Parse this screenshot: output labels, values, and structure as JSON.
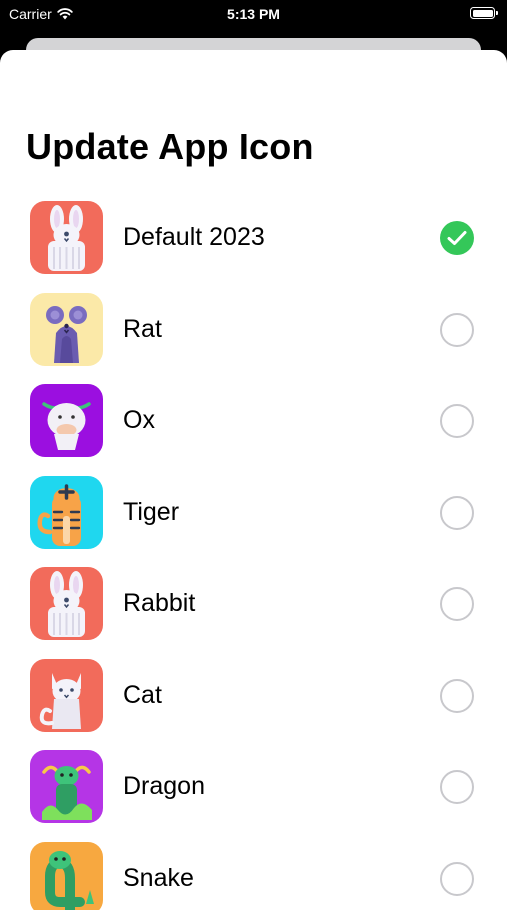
{
  "status_bar": {
    "carrier": "Carrier",
    "time": "5:13 PM"
  },
  "sheet": {
    "title": "Update App Icon",
    "options": [
      {
        "label": "Default 2023",
        "selected": true,
        "icon": "rabbit-icon",
        "bg": "#f26b5b"
      },
      {
        "label": "Rat",
        "selected": false,
        "icon": "rat-icon",
        "bg": "#fbe9a8"
      },
      {
        "label": "Ox",
        "selected": false,
        "icon": "ox-icon",
        "bg": "#9b0fe0"
      },
      {
        "label": "Tiger",
        "selected": false,
        "icon": "tiger-icon",
        "bg": "#1fd7ef"
      },
      {
        "label": "Rabbit",
        "selected": false,
        "icon": "rabbit-icon",
        "bg": "#f26b5b"
      },
      {
        "label": "Cat",
        "selected": false,
        "icon": "cat-icon",
        "bg": "#f26b5b"
      },
      {
        "label": "Dragon",
        "selected": false,
        "icon": "dragon-icon",
        "bg": "#b535e6"
      },
      {
        "label": "Snake",
        "selected": false,
        "icon": "snake-icon",
        "bg": "#f7a840"
      }
    ]
  },
  "colors": {
    "accent_selected": "#34c759",
    "radio_border": "#c8c8cc"
  }
}
